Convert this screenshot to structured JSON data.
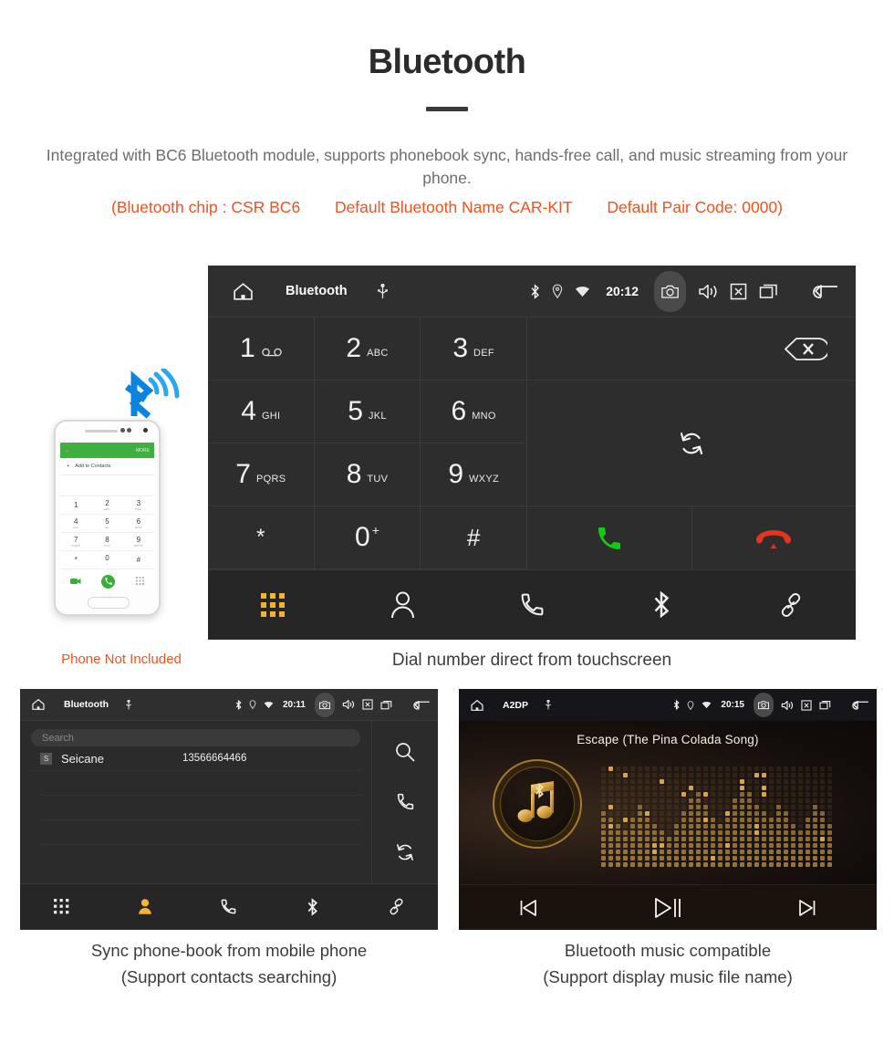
{
  "header": {
    "title": "Bluetooth",
    "subtitle": "Integrated with BC6 Bluetooth module, supports phonebook sync, hands-free call, and music streaming from your phone.",
    "spec_chip": "(Bluetooth chip : CSR BC6",
    "spec_name": "Default Bluetooth Name CAR-KIT",
    "spec_pair": "Default Pair Code: 0000)",
    "accent_color": "#f4511e",
    "text_color": "#6d6d6d"
  },
  "phone_illustration": {
    "caption": "Phone Not Included",
    "screen_header_back": "←",
    "screen_header_more": "MORE",
    "add_contacts_label": "Add to Contacts",
    "keys": [
      {
        "digit": "1",
        "letters": ""
      },
      {
        "digit": "2",
        "letters": "ABC"
      },
      {
        "digit": "3",
        "letters": "DEF"
      },
      {
        "digit": "4",
        "letters": "GHI"
      },
      {
        "digit": "5",
        "letters": "JKL"
      },
      {
        "digit": "6",
        "letters": "MNO"
      },
      {
        "digit": "7",
        "letters": "PQRS"
      },
      {
        "digit": "8",
        "letters": "TUV"
      },
      {
        "digit": "9",
        "letters": "WXYZ"
      },
      {
        "digit": "*",
        "letters": ""
      },
      {
        "digit": "0",
        "letters": "+"
      },
      {
        "digit": "#",
        "letters": ""
      }
    ]
  },
  "dialer": {
    "statusbar": {
      "title": "Bluetooth",
      "time": "20:12",
      "icons": [
        "home-icon",
        "usb-icon",
        "bluetooth-icon",
        "location-icon",
        "wifi-icon",
        "camera-icon",
        "volume-icon",
        "close-icon",
        "recents-icon",
        "back-icon"
      ]
    },
    "keys": [
      {
        "digit": "1",
        "letters": "",
        "icon": "voicemail-icon"
      },
      {
        "digit": "2",
        "letters": "ABC"
      },
      {
        "digit": "3",
        "letters": "DEF"
      },
      {
        "digit": "4",
        "letters": "GHI"
      },
      {
        "digit": "5",
        "letters": "JKL"
      },
      {
        "digit": "6",
        "letters": "MNO"
      },
      {
        "digit": "7",
        "letters": "PQRS"
      },
      {
        "digit": "8",
        "letters": "TUV"
      },
      {
        "digit": "9",
        "letters": "WXYZ"
      },
      {
        "digit": "*",
        "letters": ""
      },
      {
        "digit": "0",
        "letters": "+"
      },
      {
        "digit": "#",
        "letters": ""
      }
    ],
    "actions": {
      "backspace": "backspace-icon",
      "sync": "sync-icon",
      "call": "call-icon",
      "hangup": "hangup-icon",
      "call_color": "#16c916",
      "hangup_color": "#e8331c"
    },
    "nav": [
      {
        "name": "keypad",
        "icon": "keypad-icon",
        "active": true
      },
      {
        "name": "contacts",
        "icon": "person-icon",
        "active": false
      },
      {
        "name": "call-log",
        "icon": "phone-icon",
        "active": false
      },
      {
        "name": "bluetooth",
        "icon": "bluetooth-icon",
        "active": false
      },
      {
        "name": "pair",
        "icon": "link-icon",
        "active": false
      }
    ],
    "nav_active_color": "#f5b335",
    "caption": "Dial number direct from touchscreen"
  },
  "phonebook": {
    "statusbar": {
      "title": "Bluetooth",
      "time": "20:11"
    },
    "search_placeholder": "Search",
    "contacts": [
      {
        "initial": "S",
        "name": "Seicane",
        "number": "13566664466"
      }
    ],
    "side_actions": [
      "search-icon",
      "phone-icon",
      "sync-icon"
    ],
    "nav": [
      {
        "name": "keypad",
        "icon": "keypad-icon",
        "active": false
      },
      {
        "name": "contacts",
        "icon": "person-icon",
        "active": true
      },
      {
        "name": "call-log",
        "icon": "phone-icon",
        "active": false
      },
      {
        "name": "bluetooth",
        "icon": "bluetooth-icon",
        "active": false
      },
      {
        "name": "pair",
        "icon": "link-icon",
        "active": false
      }
    ],
    "caption_line1": "Sync phone-book from mobile phone",
    "caption_line2": "(Support contacts searching)"
  },
  "music": {
    "statusbar": {
      "title": "A2DP",
      "time": "20:15"
    },
    "song_title": "Escape (The Pina Colada Song)",
    "controls": [
      {
        "name": "previous",
        "icon": "skip-previous-icon"
      },
      {
        "name": "play-pause",
        "icon": "play-pause-icon"
      },
      {
        "name": "next",
        "icon": "skip-next-icon"
      }
    ],
    "accent_color": "#d9a441",
    "caption_line1": "Bluetooth music compatible",
    "caption_line2": "(Support display music file name)"
  }
}
